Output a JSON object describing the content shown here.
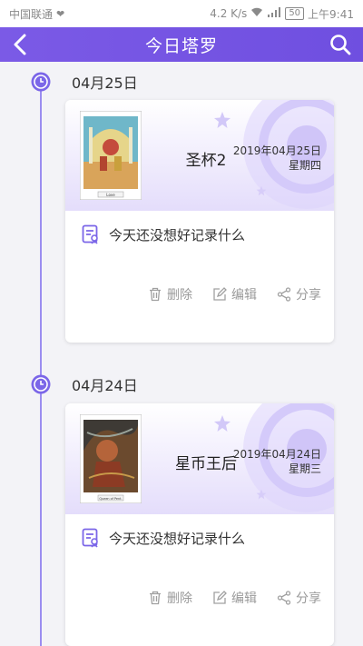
{
  "statusbar": {
    "carrier": "中国联通",
    "speed": "4.2 K/s",
    "battery": "50",
    "time": "上午9:41"
  },
  "header": {
    "title": "今日塔罗"
  },
  "entries": [
    {
      "date": "04月25日",
      "card_name": "圣杯2",
      "full_date": "2019年04月25日",
      "weekday": "星期四",
      "card_caption": "Love",
      "note": "今天还没想好记录什么",
      "actions": {
        "delete": "删除",
        "edit": "编辑",
        "share": "分享"
      }
    },
    {
      "date": "04月24日",
      "card_name": "星币王后",
      "full_date": "2019年04月24日",
      "weekday": "星期三",
      "card_caption": "Queen of Pent.",
      "note": "今天还没想好记录什么",
      "actions": {
        "delete": "删除",
        "edit": "编辑",
        "share": "分享"
      }
    }
  ]
}
